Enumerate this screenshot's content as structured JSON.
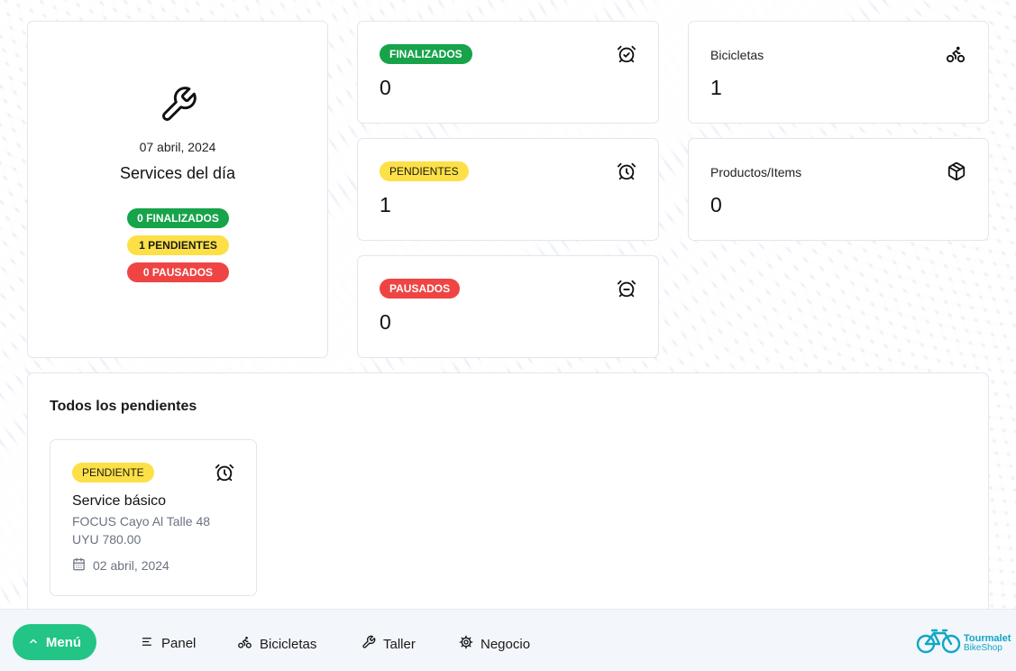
{
  "summary": {
    "icon": "wrench-icon",
    "date": "07 abril, 2024",
    "title": "Services del día",
    "pills": [
      {
        "label": "0 FINALIZADOS",
        "color": "#16a34a"
      },
      {
        "label": "1 PENDIENTES",
        "color": "#fde047"
      },
      {
        "label": "0 PAUSADOS",
        "color": "#ef4444"
      }
    ]
  },
  "stats": {
    "finalizados": {
      "badge": "FINALIZADOS",
      "value": "0",
      "icon": "alarm-check-icon"
    },
    "pendientes": {
      "badge": "PENDIENTES",
      "value": "1",
      "icon": "alarm-clock-icon"
    },
    "pausados": {
      "badge": "PAUSADOS",
      "value": "0",
      "icon": "alarm-minus-icon"
    },
    "bicicletas": {
      "label": "Bicicletas",
      "value": "1",
      "icon": "bicycle-icon"
    },
    "productos": {
      "label": "Productos/Items",
      "value": "0",
      "icon": "box-icon"
    }
  },
  "pendientes_section": {
    "title": "Todos los pendientes",
    "jobs": [
      {
        "badge": "PENDIENTE",
        "title": "Service básico",
        "model": "FOCUS Cayo Al Talle 48",
        "price": "UYU 780.00",
        "date": "02 abril, 2024"
      }
    ]
  },
  "bottombar": {
    "menu_label": "Menú",
    "nav": [
      {
        "label": "Panel",
        "icon": "list-icon"
      },
      {
        "label": "Bicicletas",
        "icon": "bicycle-icon"
      },
      {
        "label": "Taller",
        "icon": "wrench-icon"
      },
      {
        "label": "Negocio",
        "icon": "gear-icon"
      }
    ],
    "logo": {
      "name": "Tourmalet",
      "sub": "BikeShop"
    }
  },
  "colors": {
    "green": "#16a34a",
    "yellow": "#fde047",
    "red": "#ef4444",
    "menu_button": "#22c585",
    "logo": "#10a7c4"
  }
}
